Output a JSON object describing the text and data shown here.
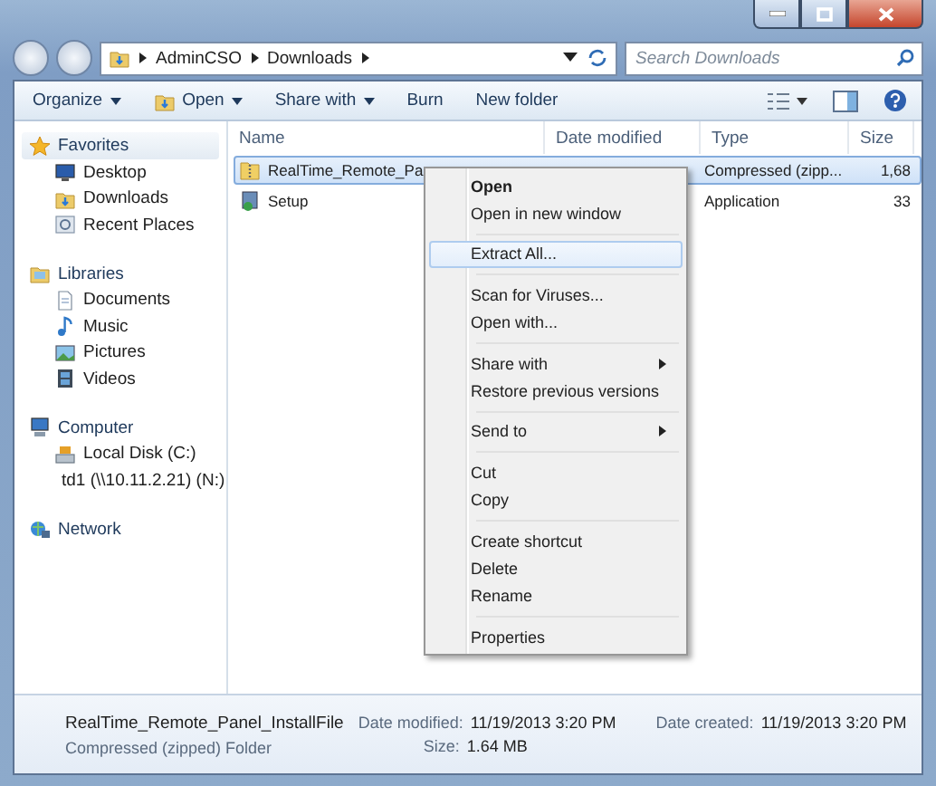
{
  "address": {
    "crumbs": [
      "AdminCSO",
      "Downloads"
    ]
  },
  "search": {
    "placeholder": "Search Downloads"
  },
  "toolbar": [
    {
      "label": "Organize",
      "kind": "dropdown"
    },
    {
      "label": "Open",
      "kind": "open"
    },
    {
      "label": "Share with",
      "kind": "dropdown"
    },
    {
      "label": "Burn",
      "kind": "plain"
    },
    {
      "label": "New folder",
      "kind": "plain"
    }
  ],
  "sidebar": [
    {
      "label": "Favorites",
      "kind": "star",
      "children": [
        {
          "label": "Desktop",
          "kind": "desktop"
        },
        {
          "label": "Downloads",
          "kind": "downloads"
        },
        {
          "label": "Recent Places",
          "kind": "recent"
        }
      ]
    },
    {
      "label": "Libraries",
      "kind": "library",
      "children": [
        {
          "label": "Documents",
          "kind": "document"
        },
        {
          "label": "Music",
          "kind": "music"
        },
        {
          "label": "Pictures",
          "kind": "pictures"
        },
        {
          "label": "Videos",
          "kind": "videos"
        }
      ]
    },
    {
      "label": "Computer",
      "kind": "computer",
      "children": [
        {
          "label": "Local Disk (C:)",
          "kind": "disk"
        },
        {
          "label": "td1 (\\\\10.11.2.21) (N:)",
          "kind": "netdrive"
        }
      ]
    },
    {
      "label": "Network",
      "kind": "network"
    }
  ],
  "columns": [
    "Name",
    "Date modified",
    "Type",
    "Size"
  ],
  "files": [
    {
      "name": "RealTime_Remote_Pa",
      "type": "Compressed (zipp...",
      "size": "1,68",
      "kind": "zip",
      "selected": true
    },
    {
      "name": "Setup",
      "type": "Application",
      "size": "33",
      "kind": "setup",
      "selected": false
    }
  ],
  "context_menu": [
    [
      {
        "label": "Open",
        "bold": true,
        "submenu": false,
        "selected": false
      },
      {
        "label": "Open in new window",
        "bold": false,
        "submenu": false,
        "selected": false
      }
    ],
    [
      {
        "label": "Extract All...",
        "bold": false,
        "submenu": false,
        "selected": true
      }
    ],
    [
      {
        "label": "Scan for Viruses...",
        "bold": false,
        "submenu": false,
        "selected": false
      },
      {
        "label": "Open with...",
        "bold": false,
        "submenu": false,
        "selected": false
      }
    ],
    [
      {
        "label": "Share with",
        "bold": false,
        "submenu": true,
        "selected": false
      },
      {
        "label": "Restore previous versions",
        "bold": false,
        "submenu": false,
        "selected": false
      }
    ],
    [
      {
        "label": "Send to",
        "bold": false,
        "submenu": true,
        "selected": false
      }
    ],
    [
      {
        "label": "Cut",
        "bold": false,
        "submenu": false,
        "selected": false
      },
      {
        "label": "Copy",
        "bold": false,
        "submenu": false,
        "selected": false
      }
    ],
    [
      {
        "label": "Create shortcut",
        "bold": false,
        "submenu": false,
        "selected": false
      },
      {
        "label": "Delete",
        "bold": false,
        "submenu": false,
        "selected": false
      },
      {
        "label": "Rename",
        "bold": false,
        "submenu": false,
        "selected": false
      }
    ],
    [
      {
        "label": "Properties",
        "bold": false,
        "submenu": false,
        "selected": false
      }
    ]
  ],
  "details": {
    "name": "RealTime_Remote_Panel_InstallFile",
    "type": "Compressed (zipped) Folder",
    "fields": [
      {
        "label": "Date modified:",
        "value": "11/19/2013 3:20 PM"
      },
      {
        "label": "Date created:",
        "value": "11/19/2013 3:20 PM"
      },
      {
        "label": "Size:",
        "value": "1.64 MB"
      }
    ]
  }
}
